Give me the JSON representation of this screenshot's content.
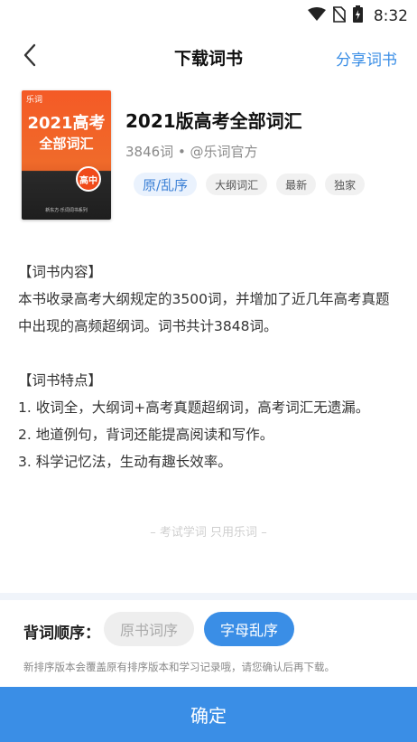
{
  "status_bar": {
    "time": "8:32"
  },
  "nav": {
    "title": "下载词书",
    "share_label": "分享词书"
  },
  "book": {
    "cover": {
      "brand": "乐词",
      "line1": "2021高考",
      "line2": "全部词汇",
      "badge": "高中",
      "footer": "新东方·乐词词书系列"
    },
    "title": "2021版高考全部词汇",
    "meta": "3846词 • @乐词官方",
    "primary_tag": "原/乱序",
    "tags": [
      "大纲词汇",
      "最新",
      "独家"
    ]
  },
  "description": {
    "content_heading": "【词书内容】",
    "content_text": "本书收录高考大纲规定的3500词，并增加了近几年高考真题中出现的高频超纲词。词书共计3848词。",
    "features_heading": "【词书特点】",
    "features": [
      "1. 收词全，大纲词+高考真题超纲词，高考词汇无遗漏。",
      "2. 地道例句，背词还能提高阅读和写作。",
      "3. 科学记忆法，生动有趣长效率。"
    ]
  },
  "slogan": "– 考试学词 只用乐词 –",
  "order": {
    "label": "背词顺序：",
    "options": [
      {
        "label": "原书词序",
        "selected": false
      },
      {
        "label": "字母乱序",
        "selected": true
      }
    ],
    "notice": "新排序版本会覆盖原有排序版本和学习记录哦，请您确认后再下载。"
  },
  "confirm_label": "确定",
  "colors": {
    "accent": "#3a8ee6",
    "cover_orange": "#f45a26"
  }
}
